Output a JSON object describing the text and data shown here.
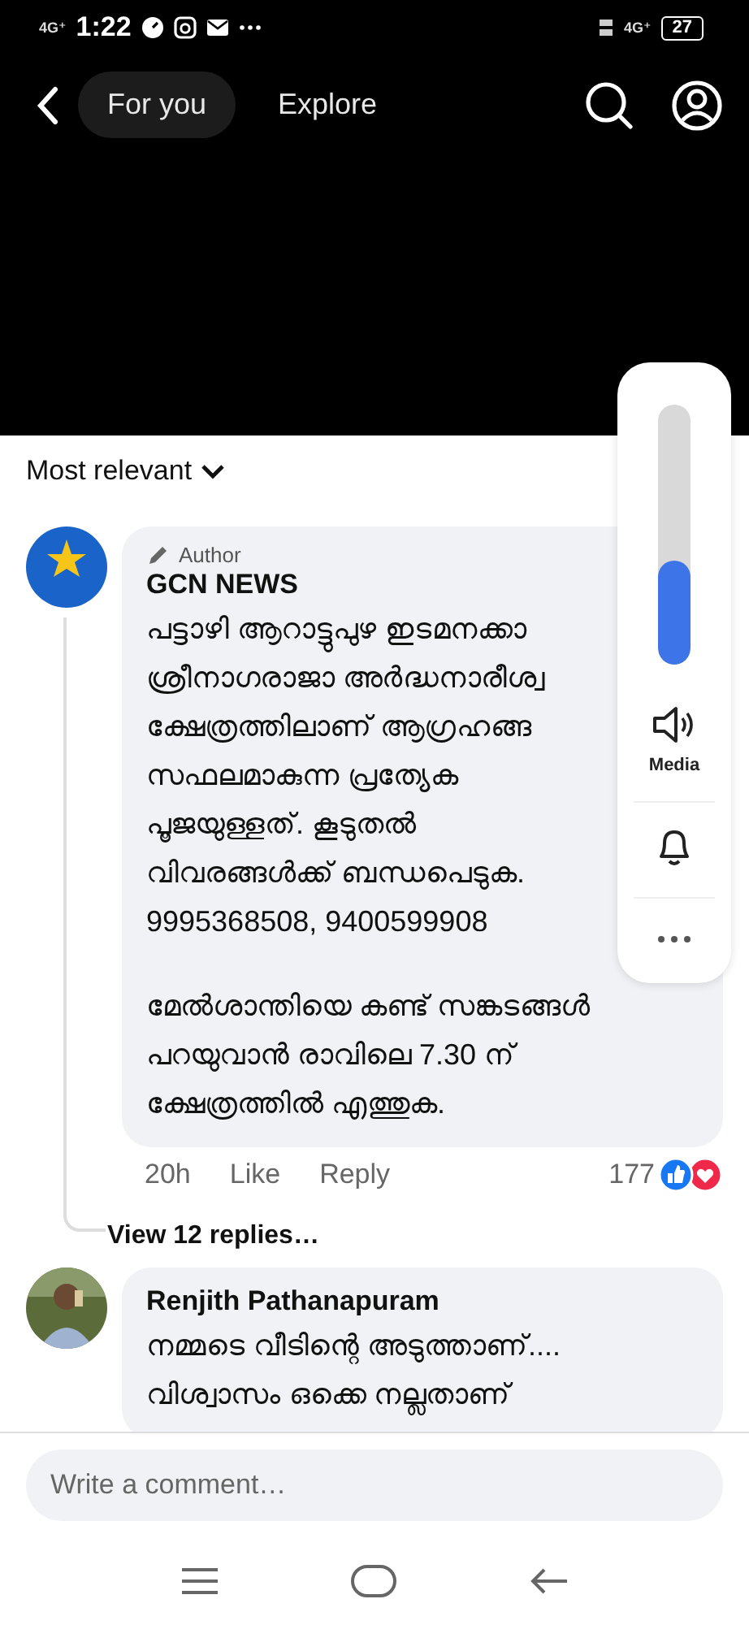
{
  "status_bar": {
    "network_left": "4G⁺",
    "time": "1:22",
    "network_right": "4G⁺",
    "battery": "27"
  },
  "nav": {
    "tabs": [
      {
        "label": "For you",
        "selected": true
      },
      {
        "label": "Explore",
        "selected": false
      }
    ]
  },
  "sort": {
    "label": "Most relevant"
  },
  "comments": [
    {
      "badge": "Author",
      "name": "GCN NEWS",
      "kind": "logo",
      "paragraphs": [
        [
          "പട്ടാഴി ആറാട്ടുപുഴ ഇടമനക്കാ",
          "ശ്രീനാഗരാജാ അർദ്ധനാരീശ്വ",
          "ക്ഷേത്രത്തിലാണ് ആഗ്രഹങ്ങ",
          "സഫലമാകുന്ന പ്രത്യേക",
          "പൂജയുള്ളത്. കൂടുതൽ",
          "വിവരങ്ങൾക്ക് ബന്ധപെടുക.",
          "9995368508, 9400599908"
        ],
        [
          "മേൽശാന്തിയെ കണ്ട് സങ്കടങ്ങൾ",
          "പറയുവാൻ രാവിലെ 7.30 ന്",
          "ക്ഷേത്രത്തിൽ എത്തുക."
        ]
      ],
      "time": "20h",
      "like": "Like",
      "reply": "Reply",
      "reactions": "177",
      "view_replies": "View 12 replies…"
    },
    {
      "name": "Renjith Pathanapuram",
      "kind": "picture",
      "paragraphs": [
        [
          "നമ്മടെ വീടിന്റെ അടുത്താണ്....",
          "വിശ്വാസം ഒക്കെ നല്ലതാണ്"
        ]
      ]
    }
  ],
  "composer": {
    "placeholder": "Write a comment…"
  },
  "volume_panel": {
    "level": 0.4,
    "label": "Media"
  }
}
